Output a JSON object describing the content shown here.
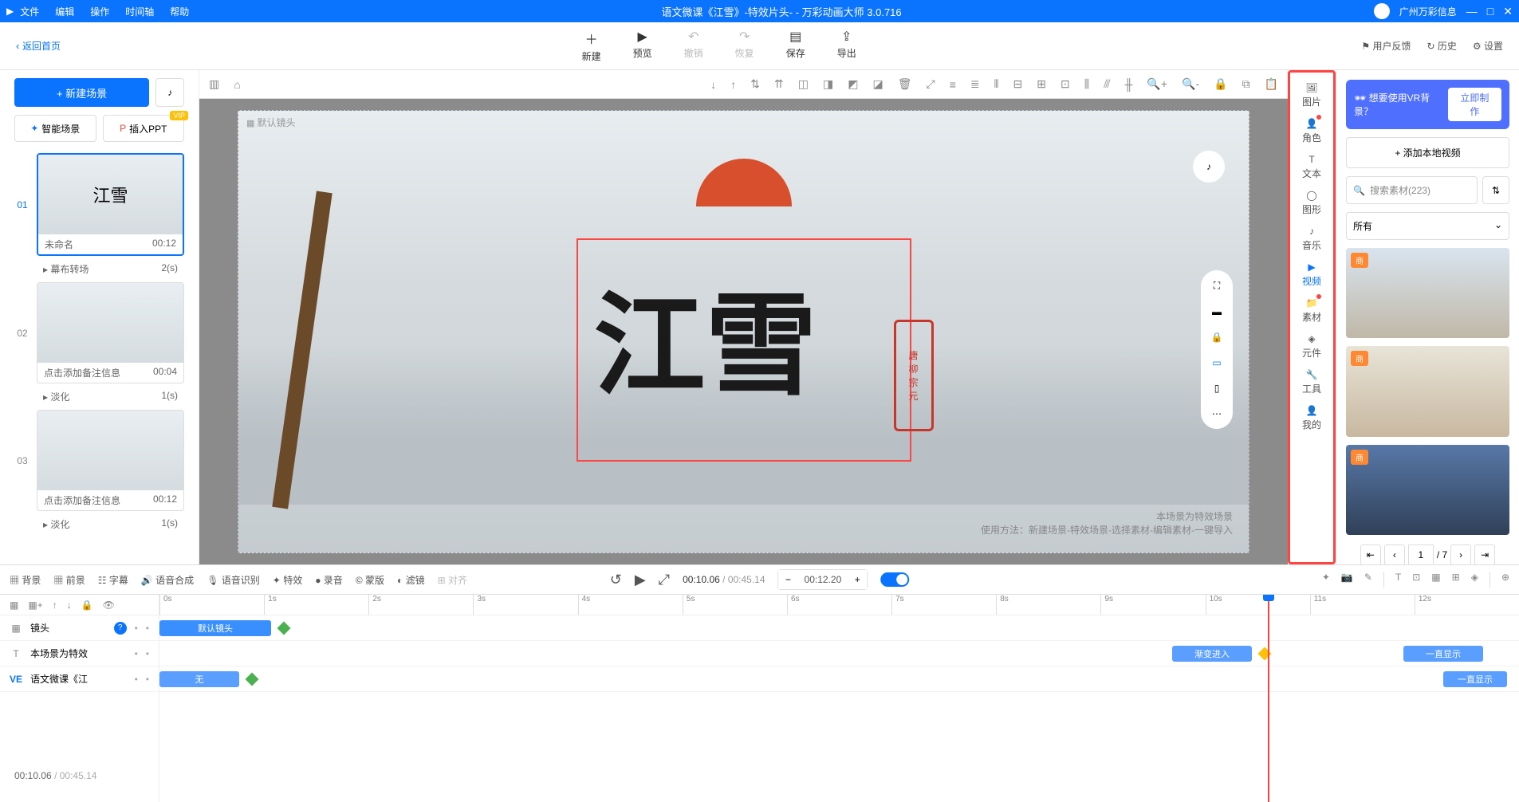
{
  "titlebar": {
    "menu": [
      "文件",
      "编辑",
      "操作",
      "时间轴",
      "帮助"
    ],
    "title": "语文微课《江雪》-特效片头- - 万彩动画大师 3.0.716",
    "user": "广州万彩信息"
  },
  "topbar": {
    "back": "返回首页",
    "buttons": [
      {
        "label": "新建",
        "icon": "＋"
      },
      {
        "label": "预览",
        "icon": "▶"
      },
      {
        "label": "撤销",
        "icon": "↶",
        "disabled": true
      },
      {
        "label": "恢复",
        "icon": "↷",
        "disabled": true
      },
      {
        "label": "保存",
        "icon": "▤"
      },
      {
        "label": "导出",
        "icon": "⇪"
      }
    ],
    "right": [
      "用户反馈",
      "历史",
      "设置"
    ]
  },
  "leftpanel": {
    "newscene": "+ 新建场景",
    "smart": "智能场景",
    "insertppt": "插入PPT",
    "vip": "VIP",
    "scenes": [
      {
        "idx": "01",
        "title": "未命名",
        "dur": "00:12",
        "thumb": "江雪",
        "active": true,
        "trans": "幕布转场",
        "transdur": "2(s)"
      },
      {
        "idx": "02",
        "title": "点击添加备注信息",
        "dur": "00:04",
        "thumb": "",
        "trans": "淡化",
        "transdur": "1(s)"
      },
      {
        "idx": "03",
        "title": "点击添加备注信息",
        "dur": "00:12",
        "thumb": "",
        "trans": "淡化",
        "transdur": "1(s)"
      }
    ],
    "timestatus": {
      "cur": "00:10.06",
      "total": "/ 00:45.14"
    }
  },
  "canvas": {
    "defaultlens": "默认镜头",
    "calligraphy": "江雪",
    "seal": [
      "唐",
      "柳",
      "宗",
      "元"
    ],
    "wm1": "本场景为特效场景",
    "wm2": "使用方法：新建场景-特效场景-选择素材-编辑素材-一键导入"
  },
  "asidebar": [
    {
      "label": "图片"
    },
    {
      "label": "角色",
      "dot": true
    },
    {
      "label": "文本"
    },
    {
      "label": "图形"
    },
    {
      "label": "音乐"
    },
    {
      "label": "视频",
      "active": true
    },
    {
      "label": "素材",
      "dot": true
    },
    {
      "label": "元件"
    },
    {
      "label": "工具"
    },
    {
      "label": "我的"
    }
  ],
  "rightpanel": {
    "vrprompt": "想要使用VR背景？",
    "vrbtn": "立即制作",
    "addvideo": "+ 添加本地视频",
    "search": "搜索素材(223)",
    "dropdown": "所有",
    "materials": [
      {
        "badge": "商"
      },
      {
        "badge": "商"
      },
      {
        "badge": "商"
      }
    ],
    "page": {
      "cur": "1",
      "total": "/ 7"
    }
  },
  "tlheader": {
    "tools": [
      {
        "i": "▦",
        "l": "背景"
      },
      {
        "i": "▦",
        "l": "前景"
      },
      {
        "i": "☷",
        "l": "字幕"
      },
      {
        "i": "🔊",
        "l": "语音合成"
      },
      {
        "i": "🎙",
        "l": "语音识别"
      },
      {
        "i": "✦",
        "l": "特效"
      },
      {
        "i": "●",
        "l": "录音"
      },
      {
        "i": "©",
        "l": "蒙版"
      },
      {
        "i": "◐",
        "l": "滤镜"
      },
      {
        "i": "⊞",
        "l": "对齐"
      }
    ],
    "time": {
      "cur": "00:10.06",
      "total": "/ 00:45.14"
    },
    "stepper": "00:12.20"
  },
  "timeline": {
    "ticks": [
      "0s",
      "1s",
      "2s",
      "3s",
      "4s",
      "5s",
      "6s",
      "7s",
      "8s",
      "9s",
      "10s",
      "11s",
      "12s"
    ],
    "tracks": [
      {
        "ico": "▦",
        "name": "镜头",
        "help": true
      },
      {
        "ico": "T",
        "name": "本场景为特效"
      },
      {
        "ico": "VE",
        "name": "语文微课《江"
      }
    ],
    "bars": {
      "lens": "默认镜头",
      "none": "无",
      "grad": "渐变进入",
      "always1": "一直显示",
      "always2": "一直显示"
    }
  }
}
